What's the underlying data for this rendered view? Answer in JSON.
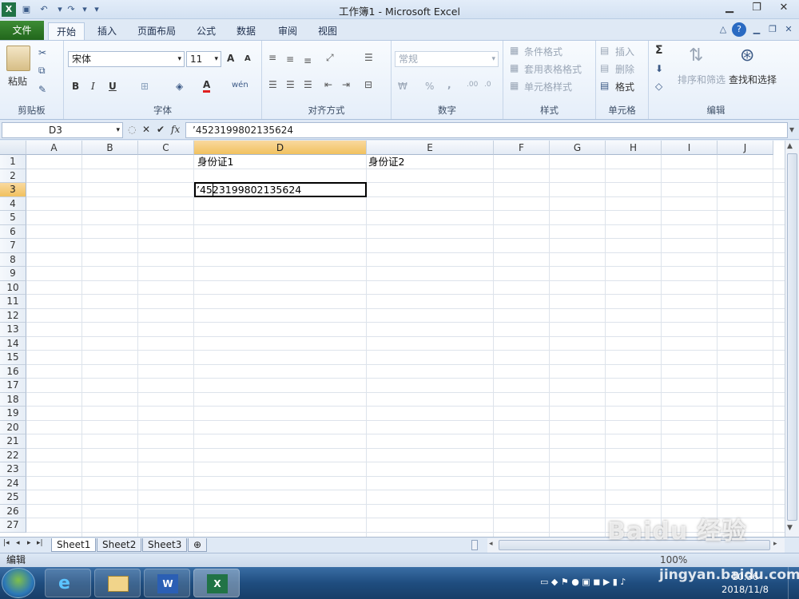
{
  "window": {
    "title": "工作簿1 - Microsoft Excel"
  },
  "tabs": [
    "文件",
    "开始",
    "插入",
    "页面布局",
    "公式",
    "数据",
    "审阅",
    "视图"
  ],
  "ribbon": {
    "clipboard": {
      "label": "剪贴板",
      "paste": "粘贴"
    },
    "font": {
      "label": "字体",
      "name": "宋体",
      "size": "11",
      "bold": "B",
      "italic": "I",
      "underline": "U",
      "grow": "A",
      "shrink": "A",
      "color": "A"
    },
    "alignment": {
      "label": "对齐方式"
    },
    "number": {
      "label": "数字",
      "format": "常规",
      "percent": "%",
      "comma": ","
    },
    "styles": {
      "label": "样式",
      "conditional": "条件格式",
      "table": "套用表格格式",
      "cell": "单元格样式"
    },
    "cells": {
      "label": "单元格",
      "insert": "插入",
      "delete": "删除",
      "format": "格式"
    },
    "editing": {
      "label": "编辑",
      "sigma": "Σ",
      "sort": "排序和筛选",
      "find": "查找和选择"
    }
  },
  "formula_bar": {
    "name_box": "D3",
    "fx": "fx",
    "content": "’4523199802135624"
  },
  "columns": [
    "A",
    "B",
    "C",
    "D",
    "E",
    "F",
    "G",
    "H",
    "I",
    "J"
  ],
  "rows": [
    "1",
    "2",
    "3",
    "4",
    "5",
    "6",
    "7",
    "8",
    "9",
    "10",
    "11",
    "12",
    "13",
    "14",
    "15",
    "16",
    "17",
    "18",
    "19",
    "20",
    "21",
    "22",
    "23",
    "24",
    "25",
    "26",
    "27"
  ],
  "cells": {
    "D1": "身份证1",
    "E1": "身份证2",
    "D3": "’4523199802135624"
  },
  "sheets": [
    "Sheet1",
    "Sheet2",
    "Sheet3"
  ],
  "status": {
    "mode": "编辑",
    "zoom": "100%"
  },
  "taskbar": {
    "time": "10:36",
    "date": "2018/11/8"
  },
  "watermark": {
    "brand": "Baidu 经验",
    "url": "jingyan.baidu.com"
  }
}
